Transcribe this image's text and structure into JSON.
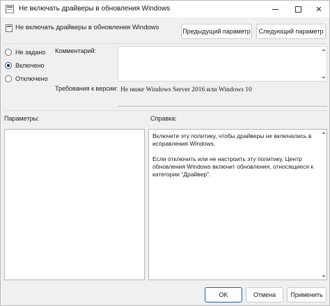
{
  "window": {
    "title": "Не включать драйверы в обновления Windows",
    "icon": "policy-icon"
  },
  "header": {
    "title": "Не включать драйверы в обновления Windows",
    "prev_button": "Предыдущий параметр",
    "next_button": "Следующий параметр"
  },
  "state_options": [
    {
      "label": "Не задано",
      "checked": false
    },
    {
      "label": "Включено",
      "checked": true
    },
    {
      "label": "Отключено",
      "checked": false
    }
  ],
  "comment": {
    "label": "Комментарий:",
    "value": ""
  },
  "supported": {
    "label": "Требования к версии:",
    "value": "Не ниже Windows Server 2016 или Windows 10"
  },
  "options_panel": {
    "label": "Параметры:"
  },
  "help_panel": {
    "label": "Справка:",
    "paragraphs": [
      "Включите эту политику, чтобы драйверы не включались в исправления Windows.",
      "Если отключить или не настроить эту политику, Центр обновления Windows включит обновления, относящиеся к категории \"Драйвер\"."
    ]
  },
  "footer": {
    "ok": "OK",
    "cancel": "Отмена",
    "apply": "Применить"
  }
}
